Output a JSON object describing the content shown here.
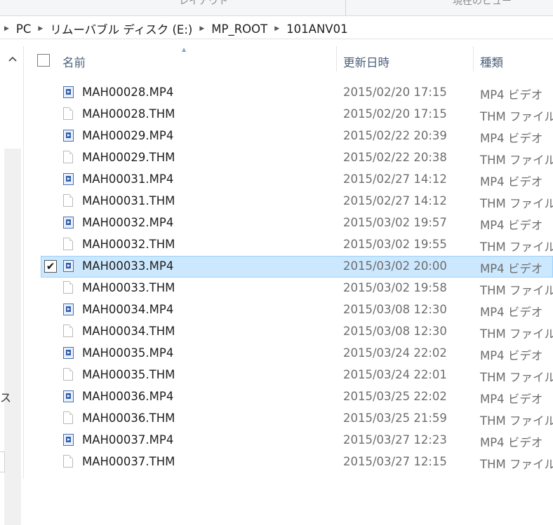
{
  "ribbon": {
    "group_left": "レイアウト",
    "group_right": "現在のビュー"
  },
  "breadcrumb": [
    "PC",
    "リムーバブル ディスク (E:)",
    "MP_ROOT",
    "101ANV01"
  ],
  "columns": {
    "name": "名前",
    "date": "更新日時",
    "type": "種類"
  },
  "nav": {
    "fragment": "ス"
  },
  "files": [
    {
      "name": "MAH00028.MP4",
      "date": "2015/02/20 17:15",
      "type": "MP4 ビデオ",
      "kind": "video",
      "selected": false
    },
    {
      "name": "MAH00028.THM",
      "date": "2015/02/20 17:15",
      "type": "THM ファイル",
      "kind": "file",
      "selected": false
    },
    {
      "name": "MAH00029.MP4",
      "date": "2015/02/22 20:39",
      "type": "MP4 ビデオ",
      "kind": "video",
      "selected": false
    },
    {
      "name": "MAH00029.THM",
      "date": "2015/02/22 20:38",
      "type": "THM ファイル",
      "kind": "file",
      "selected": false
    },
    {
      "name": "MAH00031.MP4",
      "date": "2015/02/27 14:12",
      "type": "MP4 ビデオ",
      "kind": "video",
      "selected": false
    },
    {
      "name": "MAH00031.THM",
      "date": "2015/02/27 14:12",
      "type": "THM ファイル",
      "kind": "file",
      "selected": false
    },
    {
      "name": "MAH00032.MP4",
      "date": "2015/03/02 19:57",
      "type": "MP4 ビデオ",
      "kind": "video",
      "selected": false
    },
    {
      "name": "MAH00032.THM",
      "date": "2015/03/02 19:55",
      "type": "THM ファイル",
      "kind": "file",
      "selected": false
    },
    {
      "name": "MAH00033.MP4",
      "date": "2015/03/02 20:00",
      "type": "MP4 ビデオ",
      "kind": "video",
      "selected": true
    },
    {
      "name": "MAH00033.THM",
      "date": "2015/03/02 19:58",
      "type": "THM ファイル",
      "kind": "file",
      "selected": false
    },
    {
      "name": "MAH00034.MP4",
      "date": "2015/03/08 12:30",
      "type": "MP4 ビデオ",
      "kind": "video",
      "selected": false
    },
    {
      "name": "MAH00034.THM",
      "date": "2015/03/08 12:30",
      "type": "THM ファイル",
      "kind": "file",
      "selected": false
    },
    {
      "name": "MAH00035.MP4",
      "date": "2015/03/24 22:02",
      "type": "MP4 ビデオ",
      "kind": "video",
      "selected": false
    },
    {
      "name": "MAH00035.THM",
      "date": "2015/03/24 22:01",
      "type": "THM ファイル",
      "kind": "file",
      "selected": false
    },
    {
      "name": "MAH00036.MP4",
      "date": "2015/03/25 22:02",
      "type": "MP4 ビデオ",
      "kind": "video",
      "selected": false
    },
    {
      "name": "MAH00036.THM",
      "date": "2015/03/25 21:59",
      "type": "THM ファイル",
      "kind": "file",
      "selected": false
    },
    {
      "name": "MAH00037.MP4",
      "date": "2015/03/27 12:23",
      "type": "MP4 ビデオ",
      "kind": "video",
      "selected": false
    },
    {
      "name": "MAH00037.THM",
      "date": "2015/03/27 12:15",
      "type": "THM ファイル",
      "kind": "file",
      "selected": false
    }
  ],
  "colors": {
    "selection_bg": "#cce8ff",
    "selection_border": "#99d1ff",
    "header_text": "#4c607a"
  }
}
